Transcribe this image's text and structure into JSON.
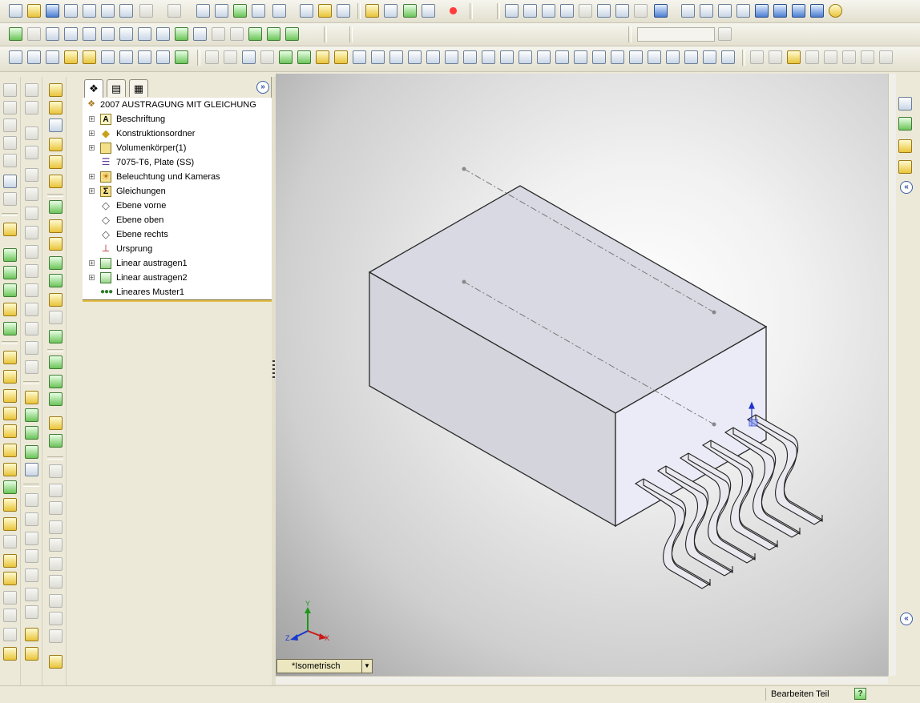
{
  "feature_tree": {
    "root_label": "2007 AUSTRAGUNG MIT GLEICHUNG",
    "items": [
      {
        "label": "Beschriftung",
        "icon": "annotation-icon",
        "expandable": true
      },
      {
        "label": "Konstruktionsordner",
        "icon": "design-binder-icon",
        "expandable": true
      },
      {
        "label": "Volumenkörper(1)",
        "icon": "solid-bodies-icon",
        "expandable": true
      },
      {
        "label": "7075-T6, Plate (SS)",
        "icon": "material-icon",
        "expandable": false
      },
      {
        "label": "Beleuchtung und Kameras",
        "icon": "lights-cameras-icon",
        "expandable": true
      },
      {
        "label": "Gleichungen",
        "icon": "equations-icon",
        "expandable": true
      },
      {
        "label": "Ebene vorne",
        "icon": "plane-icon",
        "expandable": false
      },
      {
        "label": "Ebene oben",
        "icon": "plane-icon",
        "expandable": false
      },
      {
        "label": "Ebene rechts",
        "icon": "plane-icon",
        "expandable": false
      },
      {
        "label": "Ursprung",
        "icon": "origin-icon",
        "expandable": false
      },
      {
        "label": "Linear austragen1",
        "icon": "extrude-icon",
        "expandable": true
      },
      {
        "label": "Linear austragen2",
        "icon": "extrude-icon",
        "expandable": true
      },
      {
        "label": "Lineares Muster1",
        "icon": "linear-pattern-icon",
        "expandable": false
      }
    ]
  },
  "viewport": {
    "view_orientation": "*Isometrisch",
    "triad": {
      "x": "X",
      "y": "Y",
      "z": "Z"
    }
  },
  "statusbar": {
    "mode": "Bearbeiten Teil",
    "help": "?"
  },
  "panel": {
    "expand_symbol": "»"
  },
  "task_pane": {
    "collapse_symbol": "«"
  },
  "colors": {
    "highlight_line": "#e5c04a",
    "viewport_bg": "#e6e6e6",
    "model_face_top": "#d8d8e0"
  }
}
